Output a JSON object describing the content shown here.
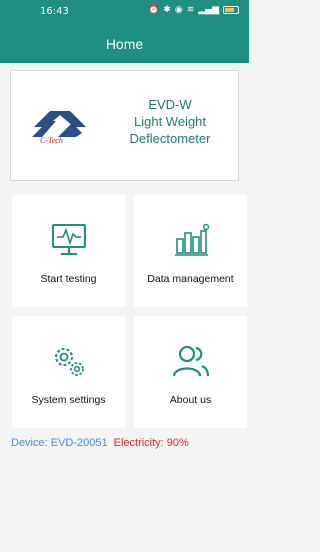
{
  "status_bar": {
    "time": "16:43",
    "icons": [
      "alarm-icon",
      "nfc-icon",
      "bluetooth-icon",
      "location-icon",
      "wifi-icon",
      "data-icon",
      "signal-icon",
      "battery-icon"
    ],
    "battery_color": "#f1c84b"
  },
  "header": {
    "title": "Home",
    "color": "#1e8f82"
  },
  "hero": {
    "logo_text": "C-Tech",
    "model": "EVD-W",
    "name_line1": "Light Weight",
    "name_line2": "Deflectometer"
  },
  "tiles": [
    {
      "label": "Start testing",
      "icon": "monitor-pulse-icon"
    },
    {
      "label": "Data management",
      "icon": "bar-chart-icon"
    },
    {
      "label": "System settings",
      "icon": "gears-icon"
    },
    {
      "label": "About us",
      "icon": "users-icon"
    }
  ],
  "footer": {
    "device": "Device: EVD-20051",
    "electricity": "Electricity: 90%"
  }
}
